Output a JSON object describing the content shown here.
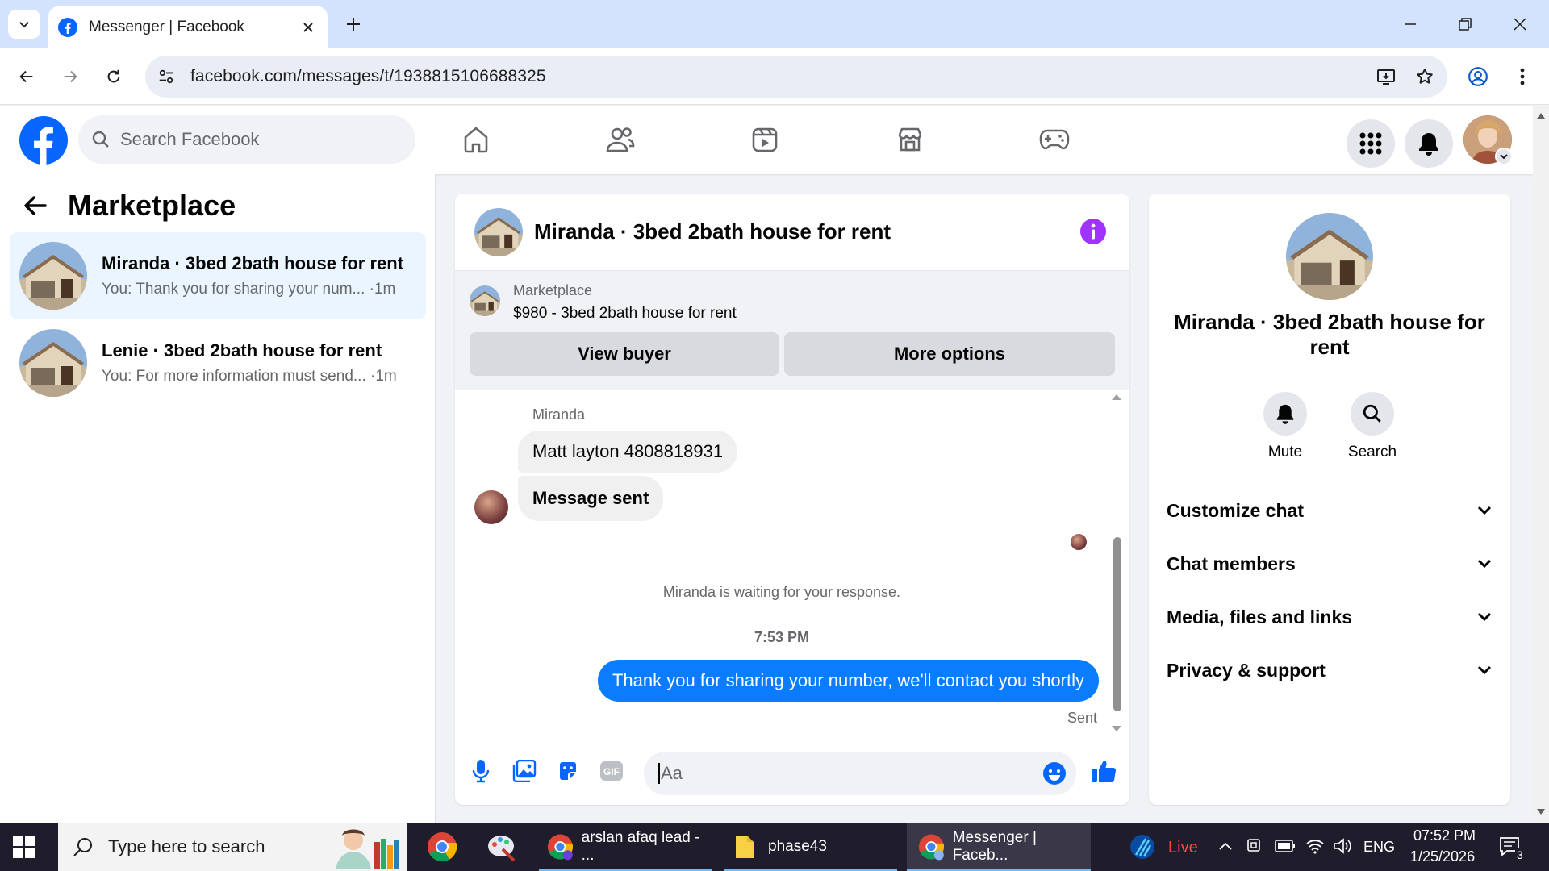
{
  "browser": {
    "tab_title": "Messenger | Facebook",
    "url": "facebook.com/messages/t/1938815106688325"
  },
  "facebook": {
    "search_placeholder": "Search Facebook"
  },
  "left_pane": {
    "title": "Marketplace",
    "conversations": [
      {
        "name": "Miranda · 3bed 2bath house for rent",
        "preview": "You: Thank you for sharing your num... ·1m",
        "active": true
      },
      {
        "name": "Lenie · 3bed 2bath house for rent",
        "preview": "You: For more information must send... ·1m",
        "active": false
      }
    ]
  },
  "chat": {
    "title": "Miranda · 3bed 2bath house for rent",
    "listing": {
      "source": "Marketplace",
      "title": "$980 - 3bed 2bath house for rent",
      "view_buyer_label": "View buyer",
      "more_options_label": "More options"
    },
    "messages": {
      "sender_name": "Miranda",
      "incoming": [
        "Matt layton 4808818931",
        "Message sent"
      ],
      "waiting_notice": "Miranda is waiting for your response.",
      "timestamp": "7:53 PM",
      "outgoing": "Thank you for sharing your number, we'll contact you shortly",
      "status": "Sent"
    },
    "composer_placeholder": "Aa"
  },
  "info_pane": {
    "name": "Miranda · 3bed 2bath house for rent",
    "actions": [
      {
        "label": "Mute",
        "icon": "bell-icon"
      },
      {
        "label": "Search",
        "icon": "search-icon"
      }
    ],
    "sections": [
      "Customize chat",
      "Chat members",
      "Media, files and links",
      "Privacy & support"
    ]
  },
  "taskbar": {
    "search_placeholder": "Type here to search",
    "apps": [
      {
        "label": "arslan afaq lead - ...",
        "icon": "chrome-icon"
      },
      {
        "label": "phase43",
        "icon": "folder-icon"
      },
      {
        "label": "Messenger | Faceb...",
        "icon": "chrome-icon"
      }
    ],
    "live_label": "Live",
    "language": "ENG",
    "time": "07:52 PM",
    "date": "1/25/2026",
    "notification_count": "3"
  },
  "colors": {
    "facebook_blue": "#0866ff",
    "messenger_blue": "#0a7cff",
    "info_purple": "#a033ff",
    "active_conv_bg": "#ebf5ff"
  }
}
